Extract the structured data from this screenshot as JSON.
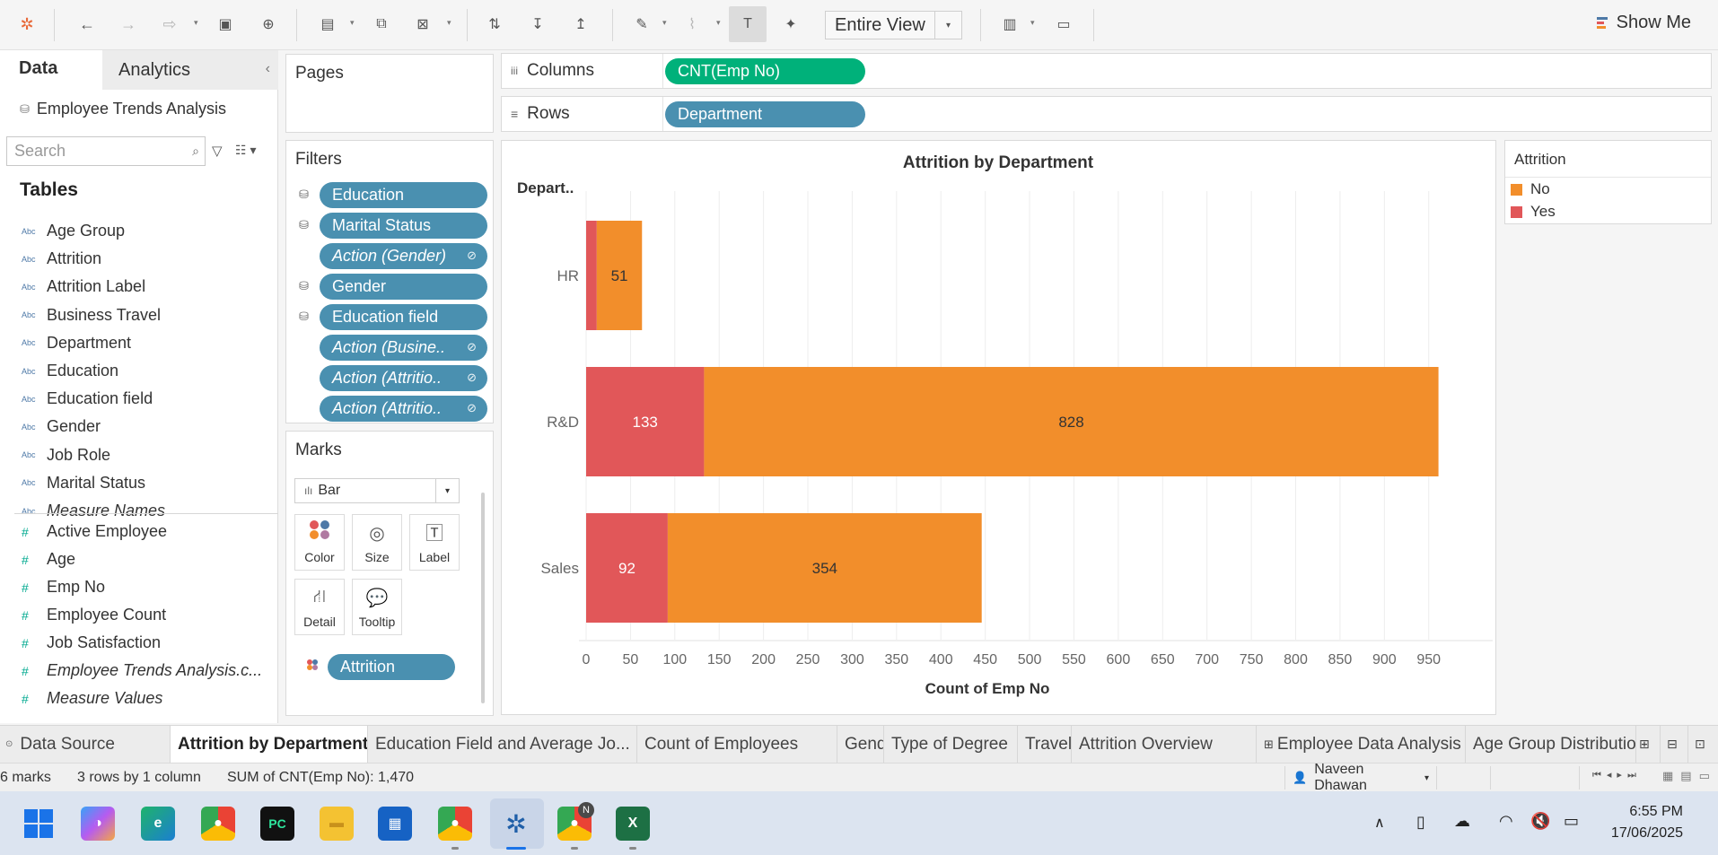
{
  "toolbar": {
    "fit_label": "Entire View",
    "show_me_label": "Show Me"
  },
  "data_pane": {
    "tab_data": "Data",
    "tab_analytics": "Analytics",
    "datasource": "Employee Trends Analysis",
    "search_placeholder": "Search",
    "tables_heading": "Tables",
    "dimension_tag": "Abc",
    "dimensions": [
      "Age Group",
      "Attrition",
      "Attrition Label",
      "Business Travel",
      "Department",
      "Education",
      "Education field",
      "Gender",
      "Job Role",
      "Marital Status",
      "Measure Names"
    ],
    "measures": [
      "Active Employee",
      "Age",
      "Emp No",
      "Employee Count",
      "Job Satisfaction",
      "Employee Trends Analysis.c...",
      "Measure Values"
    ]
  },
  "shelves": {
    "pages_title": "Pages",
    "columns_label": "Columns",
    "columns_pill": "CNT(Emp No)",
    "rows_label": "Rows",
    "rows_pill": "Department"
  },
  "filters": {
    "title": "Filters",
    "items": [
      "Education",
      "Marital Status",
      "Action (Gender)",
      "Gender",
      "Education field",
      "Action (Busine..",
      "Action (Attritio..",
      "Action (Attritio.."
    ]
  },
  "marks": {
    "title": "Marks",
    "type": "Bar",
    "buttons": [
      "Color",
      "Size",
      "Label",
      "Detail",
      "Tooltip"
    ],
    "color_pill": "Attrition"
  },
  "legend": {
    "title": "Attrition",
    "items": [
      {
        "label": "No",
        "color": "#f28e2b"
      },
      {
        "label": "Yes",
        "color": "#e15759"
      }
    ]
  },
  "chart_data": {
    "type": "bar",
    "orientation": "horizontal",
    "stacked": true,
    "title": "Attrition by Department",
    "row_header": "Depart..",
    "xlabel": "Count of Emp No",
    "categories": [
      "HR",
      "R&D",
      "Sales"
    ],
    "series": [
      {
        "name": "Yes",
        "values": [
          12,
          133,
          92
        ],
        "color": "#e15759",
        "labels": [
          "",
          "133",
          "92"
        ]
      },
      {
        "name": "No",
        "values": [
          51,
          828,
          354
        ],
        "color": "#f28e2b",
        "labels": [
          "51",
          "828",
          "354"
        ]
      }
    ],
    "xticks": [
      0,
      50,
      100,
      150,
      200,
      250,
      300,
      350,
      400,
      450,
      500,
      550,
      600,
      650,
      700,
      750,
      800,
      850,
      900,
      950
    ],
    "xlim": [
      0,
      1010
    ],
    "grid": "vertical"
  },
  "sheet_tabs": {
    "data_source": "Data Source",
    "tabs": [
      "Attrition by Department",
      "Education Field and Average Jo...",
      "Count of Employees",
      "Gender",
      "Type of Degree",
      "Travel",
      "Attrition Overview",
      "Employee Data Analysis",
      "Age Group Distributio"
    ],
    "active_index": 0
  },
  "status": {
    "marks": "6 marks",
    "dims": "3 rows by 1 column",
    "sum": "SUM of CNT(Emp No): 1,470",
    "user": "Naveen Dhawan"
  },
  "taskbar": {
    "time": "6:55 PM",
    "date": "17/06/2025",
    "badge_letter": "N"
  }
}
